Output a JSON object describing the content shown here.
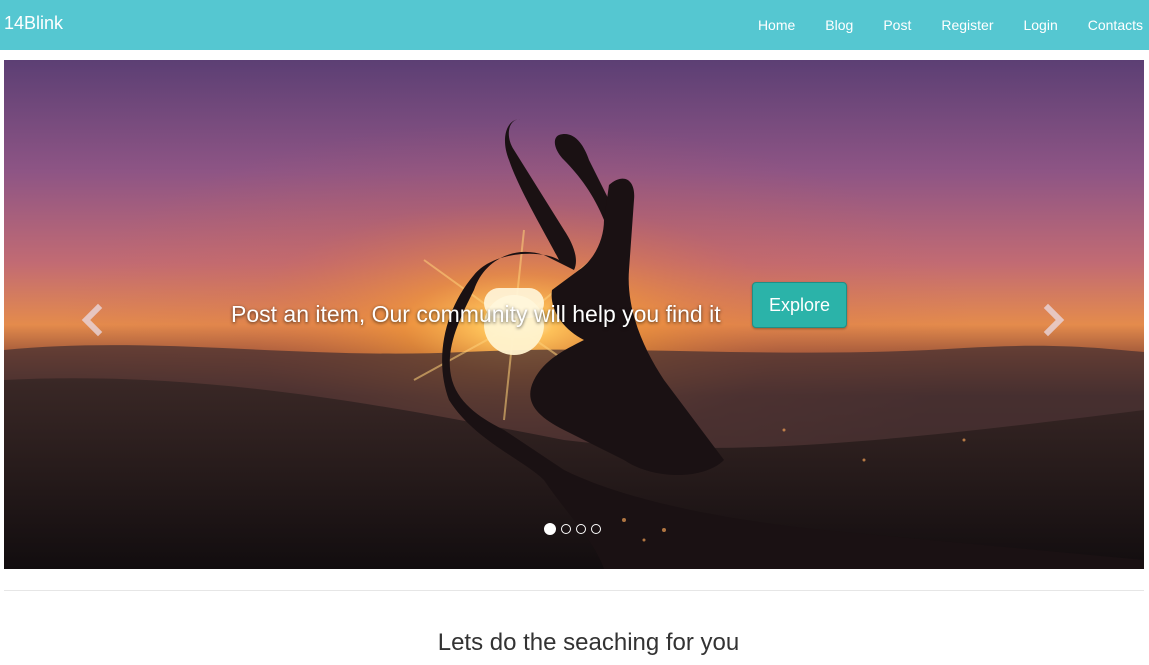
{
  "navbar": {
    "brand": "14Blink",
    "links": [
      "Home",
      "Blog",
      "Post",
      "Register",
      "Login",
      "Contacts"
    ],
    "color": "#55c7d1"
  },
  "hero": {
    "caption": "Post an item, Our community will help you find it",
    "button_label": "Explore",
    "button_color": "#2bb3a9",
    "prev_icon": "chevron-left-icon",
    "next_icon": "chevron-right-icon",
    "slide_count": 4,
    "active_slide": 1
  },
  "section": {
    "heading": "Lets do the seaching for you"
  }
}
